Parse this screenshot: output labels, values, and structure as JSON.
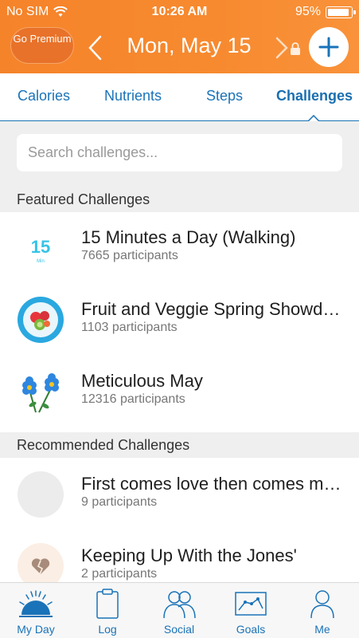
{
  "status_bar": {
    "carrier": "No SIM",
    "time": "10:26 AM",
    "battery": "95%"
  },
  "header": {
    "premium_label": "Go Premium",
    "date": "Mon, May 15",
    "accent": "#f5832a"
  },
  "tabs": [
    {
      "label": "Calories",
      "active": false
    },
    {
      "label": "Nutrients",
      "active": false
    },
    {
      "label": "Steps",
      "active": false
    },
    {
      "label": "Challenges",
      "active": true
    }
  ],
  "search": {
    "placeholder": "Search challenges..."
  },
  "sections": {
    "featured": {
      "title": "Featured Challenges",
      "items": [
        {
          "title": "15 Minutes a Day (Walking)",
          "participants": "7665 participants",
          "icon": "15-min-icon",
          "badge_number": "15",
          "badge_unit": "Min"
        },
        {
          "title": "Fruit and Veggie Spring Showdown",
          "participants": "1103 participants",
          "icon": "fruit-plate-icon"
        },
        {
          "title": "Meticulous May",
          "participants": "12316 participants",
          "icon": "flowers-icon"
        }
      ]
    },
    "recommended": {
      "title": "Recommended Challenges",
      "items": [
        {
          "title": "First comes love then comes marriage",
          "participants": "9 participants",
          "icon": "placeholder-circle-icon"
        },
        {
          "title": "Keeping Up With the Jones'",
          "participants": "2 participants",
          "icon": "broken-heart-icon"
        }
      ]
    }
  },
  "bottom_nav": [
    {
      "label": "My Day",
      "icon": "sunrise-icon"
    },
    {
      "label": "Log",
      "icon": "clipboard-icon"
    },
    {
      "label": "Social",
      "icon": "people-icon"
    },
    {
      "label": "Goals",
      "icon": "chart-icon"
    },
    {
      "label": "Me",
      "icon": "person-icon"
    }
  ]
}
